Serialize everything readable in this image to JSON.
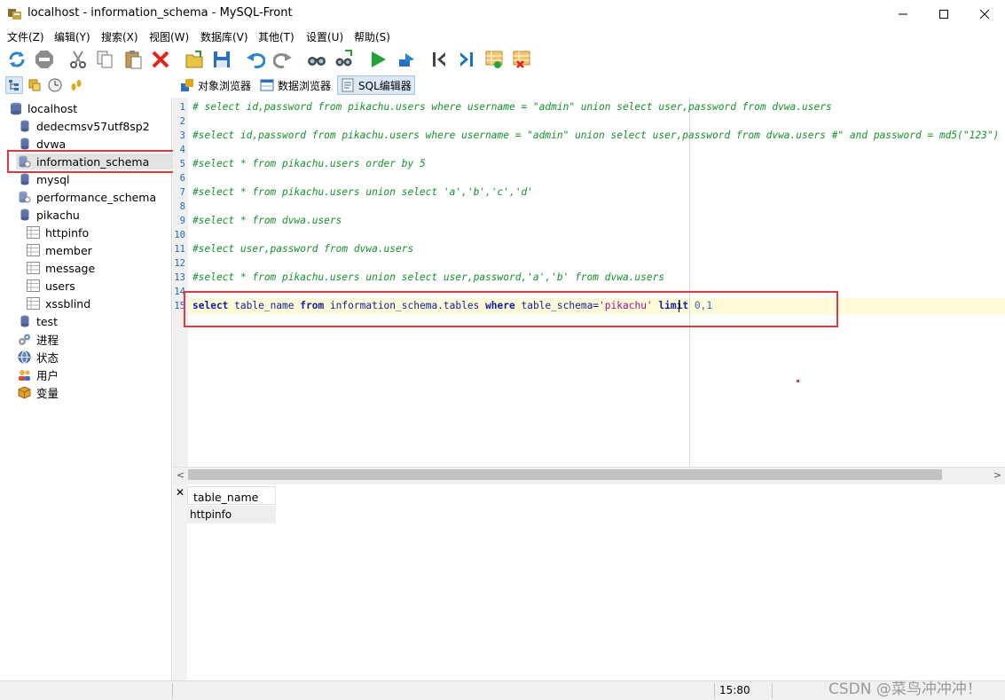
{
  "window": {
    "title": "localhost - information_schema - MySQL-Front"
  },
  "menu": [
    "文件(Z)",
    "编辑(Y)",
    "搜索(X)",
    "视图(W)",
    "数据库(V)",
    "其他(T)",
    "设置(U)",
    "帮助(S)"
  ],
  "toolbar_icons": [
    "refresh-icon",
    "stop-icon",
    "cut-icon",
    "copy-icon",
    "paste-icon",
    "delete-icon",
    "open-icon",
    "save-icon",
    "undo-icon",
    "redo-icon",
    "find-icon",
    "replace-icon",
    "run-icon",
    "run-line-icon",
    "first-icon",
    "last-icon",
    "insert-row-icon",
    "delete-row-icon"
  ],
  "view_tabs": [
    {
      "label": "对象浏览器",
      "icon": "object-browser-icon",
      "active": false
    },
    {
      "label": "数据浏览器",
      "icon": "data-browser-icon",
      "active": false
    },
    {
      "label": "SQL编辑器",
      "icon": "sql-editor-icon",
      "active": true
    }
  ],
  "tree": {
    "root": "localhost",
    "databases": [
      "dedecmsv57utf8sp2",
      "dvwa",
      "information_schema",
      "mysql",
      "performance_schema",
      "pikachu"
    ],
    "pikachu_tables": [
      "httpinfo",
      "member",
      "message",
      "users",
      "xssblind"
    ],
    "after": [
      "test"
    ],
    "extras": [
      "进程",
      "状态",
      "用户",
      "变量"
    ],
    "selected": "information_schema"
  },
  "editor": {
    "line_numbers": [
      "1",
      "2",
      "3",
      "4",
      "5",
      "6",
      "7",
      "8",
      "9",
      "10",
      "11",
      "12",
      "13",
      "14",
      "15"
    ],
    "comment_lines": {
      "l1": "# select id,password from pikachu.users where username = \"admin\" union select user,password from dvwa.users",
      "l3": "#select id,password from pikachu.users where username = \"admin\" union select user,password from dvwa.users #\" and password = md5(\"123\")",
      "l5": "#select * from pikachu.users order by 5",
      "l7": "#select * from pikachu.users union select 'a','b','c','d'",
      "l9": "#select * from dvwa.users",
      "l11": "#select user,password from dvwa.users",
      "l13": "#select * from pikachu.users union select user,password,'a','b' from dvwa.users"
    },
    "active_line": {
      "kw_select": "select",
      "col": " table_name ",
      "kw_from": "from",
      "tbl": " information_schema.tables ",
      "kw_where": "where",
      "col2": " table_schema=",
      "str": "'pikachu'",
      "sp": " ",
      "kw_limit": "limit",
      "sp2": " ",
      "nums": "0,1"
    }
  },
  "results": {
    "close_label": "✕",
    "column": "table_name",
    "rows": [
      "httpinfo"
    ]
  },
  "status": {
    "position": "15:80",
    "watermark": "CSDN @菜鸟冲冲冲！"
  },
  "colors": {
    "highlight_box": "#e0383e",
    "comment": "#14922b",
    "keyword": "#0b1fa0",
    "string": "#a11094"
  }
}
